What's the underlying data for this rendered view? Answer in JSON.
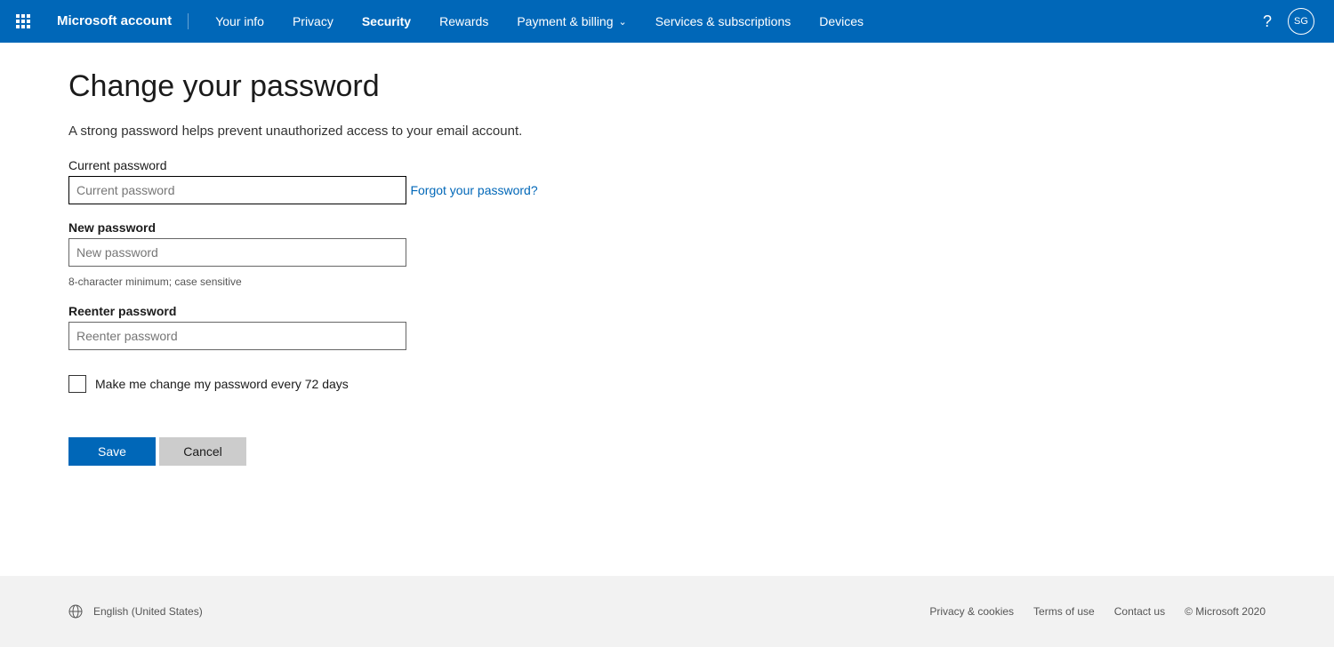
{
  "header": {
    "brand": "Microsoft account",
    "nav": [
      {
        "label": "Your info",
        "active": false
      },
      {
        "label": "Privacy",
        "active": false
      },
      {
        "label": "Security",
        "active": true
      },
      {
        "label": "Rewards",
        "active": false
      },
      {
        "label": "Payment & billing",
        "active": false,
        "dropdown": true
      },
      {
        "label": "Services & subscriptions",
        "active": false
      },
      {
        "label": "Devices",
        "active": false
      }
    ],
    "help": "?",
    "avatar_initials": "SG"
  },
  "page": {
    "title": "Change your password",
    "subtitle": "A strong password helps prevent unauthorized access to your email account.",
    "current_label": "Current password",
    "current_placeholder": "Current password",
    "forgot_link": "Forgot your password?",
    "new_label": "New password",
    "new_placeholder": "New password",
    "new_hint": "8-character minimum; case sensitive",
    "reenter_label": "Reenter password",
    "reenter_placeholder": "Reenter password",
    "checkbox_label": "Make me change my password every 72 days",
    "save_label": "Save",
    "cancel_label": "Cancel"
  },
  "footer": {
    "locale": "English (United States)",
    "links": [
      "Privacy & cookies",
      "Terms of use",
      "Contact us"
    ],
    "copyright": "© Microsoft 2020"
  }
}
